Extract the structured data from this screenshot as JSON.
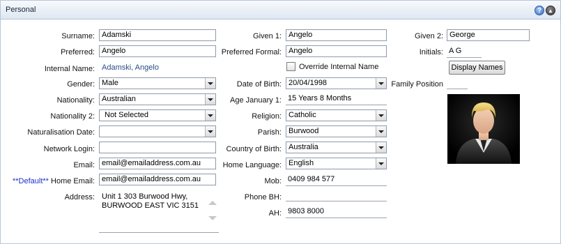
{
  "panel": {
    "title": "Personal"
  },
  "col1": {
    "surname": {
      "label": "Surname:",
      "value": "Adamski"
    },
    "preferred": {
      "label": "Preferred:",
      "value": "Angelo"
    },
    "internal_name": {
      "label": "Internal Name:",
      "value": "Adamski, Angelo"
    },
    "gender": {
      "label": "Gender:",
      "value": "Male"
    },
    "nationality": {
      "label": "Nationality:",
      "value": "Australian"
    },
    "nationality2": {
      "label": "Nationality 2:",
      "value": "Not Selected"
    },
    "naturalisation": {
      "label": "Naturalisation Date:",
      "value": ""
    },
    "network_login": {
      "label": "Network Login:",
      "value": ""
    },
    "email": {
      "label": "Email:",
      "value": "email@emailaddress.com.au"
    },
    "home_email": {
      "default_prefix": "**Default**",
      "label": " Home Email:",
      "value": "email@emailaddress.com.au"
    },
    "address": {
      "label": "Address:",
      "value": "Unit 1 303 Burwood Hwy,\nBURWOOD EAST VIC 3151"
    }
  },
  "col2": {
    "given1": {
      "label": "Given 1:",
      "value": "Angelo"
    },
    "preferred_formal": {
      "label": "Preferred Formal:",
      "value": "Angelo"
    },
    "override_internal": {
      "label": "Override Internal Name",
      "checked": false
    },
    "dob": {
      "label": "Date of Birth:",
      "value": "20/04/1998"
    },
    "age_jan1": {
      "label": "Age January 1:",
      "value": "15 Years 8 Months"
    },
    "religion": {
      "label": "Religion:",
      "value": "Catholic"
    },
    "parish": {
      "label": "Parish:",
      "value": "Burwood"
    },
    "country_birth": {
      "label": "Country of Birth:",
      "value": "Australia"
    },
    "home_language": {
      "label": "Home Language:",
      "value": "English"
    },
    "mob": {
      "label": "Mob:",
      "value": "0409 984 577"
    },
    "phone_bh": {
      "label": "Phone BH:",
      "value": ""
    },
    "ah": {
      "label": "AH:",
      "value": "9803 8000"
    }
  },
  "col3": {
    "given2": {
      "label": "Given 2:",
      "value": "George"
    },
    "initials": {
      "label": "Initials:",
      "value": "A G"
    },
    "display_names_button": "Display Names",
    "family_position": {
      "label": "Family Position",
      "value": ""
    }
  },
  "icons": {
    "help": "help-icon",
    "collapse": "collapse-up-icon"
  }
}
